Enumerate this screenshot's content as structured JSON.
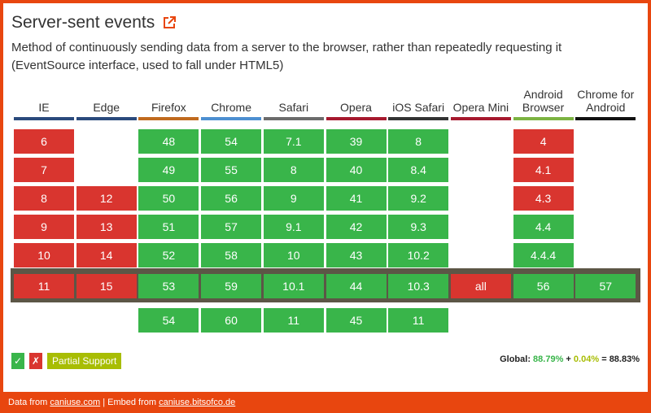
{
  "header": {
    "title": "Server-sent events",
    "description": "Method of continuously sending data from a server to the browser, rather than repeatedly requesting it (EventSource interface, used to fall under HTML5)"
  },
  "browsers": [
    {
      "name": "IE",
      "color": "#2a4a7c"
    },
    {
      "name": "Edge",
      "color": "#2a4a7c"
    },
    {
      "name": "Firefox",
      "color": "#c06a1e"
    },
    {
      "name": "Chrome",
      "color": "#4d8fd1"
    },
    {
      "name": "Safari",
      "color": "#6b6b6b"
    },
    {
      "name": "Opera",
      "color": "#a6192e"
    },
    {
      "name": "iOS Safari",
      "color": "#333333"
    },
    {
      "name": "Opera Mini",
      "color": "#a6192e"
    },
    {
      "name": "Android Browser",
      "color": "#7cb342"
    },
    {
      "name": "Chrome for Android",
      "color": "#111111"
    }
  ],
  "rows": [
    [
      {
        "v": "6",
        "s": "n"
      },
      null,
      {
        "v": "48",
        "s": "y"
      },
      {
        "v": "54",
        "s": "y"
      },
      {
        "v": "7.1",
        "s": "y"
      },
      {
        "v": "39",
        "s": "y"
      },
      {
        "v": "8",
        "s": "y"
      },
      null,
      {
        "v": "4",
        "s": "n"
      },
      null
    ],
    [
      {
        "v": "7",
        "s": "n"
      },
      null,
      {
        "v": "49",
        "s": "y"
      },
      {
        "v": "55",
        "s": "y"
      },
      {
        "v": "8",
        "s": "y"
      },
      {
        "v": "40",
        "s": "y"
      },
      {
        "v": "8.4",
        "s": "y"
      },
      null,
      {
        "v": "4.1",
        "s": "n"
      },
      null
    ],
    [
      {
        "v": "8",
        "s": "n"
      },
      {
        "v": "12",
        "s": "n"
      },
      {
        "v": "50",
        "s": "y"
      },
      {
        "v": "56",
        "s": "y"
      },
      {
        "v": "9",
        "s": "y"
      },
      {
        "v": "41",
        "s": "y"
      },
      {
        "v": "9.2",
        "s": "y"
      },
      null,
      {
        "v": "4.3",
        "s": "n"
      },
      null
    ],
    [
      {
        "v": "9",
        "s": "n"
      },
      {
        "v": "13",
        "s": "n"
      },
      {
        "v": "51",
        "s": "y"
      },
      {
        "v": "57",
        "s": "y"
      },
      {
        "v": "9.1",
        "s": "y"
      },
      {
        "v": "42",
        "s": "y"
      },
      {
        "v": "9.3",
        "s": "y"
      },
      null,
      {
        "v": "4.4",
        "s": "y"
      },
      null
    ],
    [
      {
        "v": "10",
        "s": "n"
      },
      {
        "v": "14",
        "s": "n"
      },
      {
        "v": "52",
        "s": "y"
      },
      {
        "v": "58",
        "s": "y"
      },
      {
        "v": "10",
        "s": "y"
      },
      {
        "v": "43",
        "s": "y"
      },
      {
        "v": "10.2",
        "s": "y"
      },
      null,
      {
        "v": "4.4.4",
        "s": "y"
      },
      null
    ],
    [
      {
        "v": "11",
        "s": "n"
      },
      {
        "v": "15",
        "s": "n"
      },
      {
        "v": "53",
        "s": "y"
      },
      {
        "v": "59",
        "s": "y"
      },
      {
        "v": "10.1",
        "s": "y"
      },
      {
        "v": "44",
        "s": "y"
      },
      {
        "v": "10.3",
        "s": "y"
      },
      {
        "v": "all",
        "s": "n"
      },
      {
        "v": "56",
        "s": "y"
      },
      {
        "v": "57",
        "s": "y"
      }
    ],
    [
      null,
      null,
      {
        "v": "54",
        "s": "y"
      },
      {
        "v": "60",
        "s": "y"
      },
      {
        "v": "11",
        "s": "y"
      },
      {
        "v": "45",
        "s": "y"
      },
      {
        "v": "11",
        "s": "y"
      },
      null,
      null,
      null
    ]
  ],
  "legend": {
    "yes_symbol": "✓",
    "no_symbol": "✗",
    "partial_label": "Partial Support"
  },
  "global": {
    "label": "Global:",
    "supported": "88.79%",
    "plus": "+",
    "partial": "0.04%",
    "equals": "=",
    "total": "88.83%"
  },
  "footer": {
    "data_prefix": "Data from",
    "data_link": "caniuse.com",
    "separator": "|",
    "embed_prefix": "Embed from",
    "embed_link": "caniuse.bitsofco.de"
  }
}
